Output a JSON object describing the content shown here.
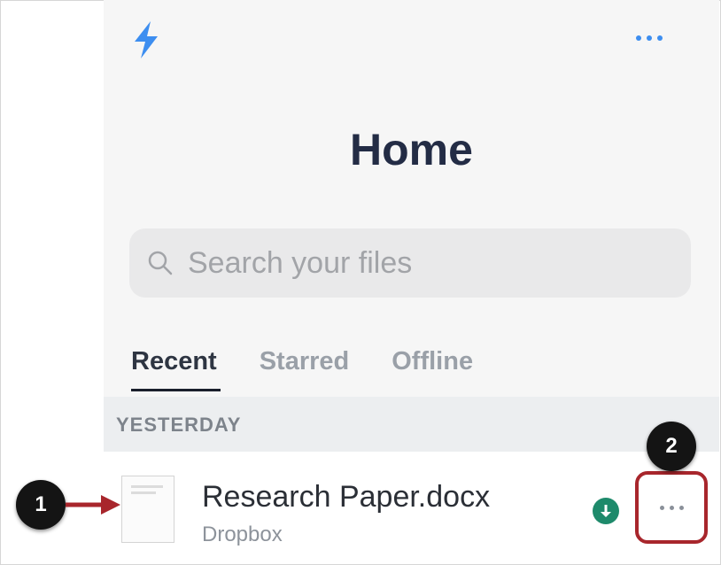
{
  "app": {
    "brand_icon": "lightning-bolt-icon",
    "more_icon": "ellipsis-icon"
  },
  "header": {
    "title": "Home"
  },
  "search": {
    "placeholder": "Search your files",
    "icon": "search-icon"
  },
  "tabs": [
    {
      "label": "Recent",
      "active": true
    },
    {
      "label": "Starred",
      "active": false
    },
    {
      "label": "Offline",
      "active": false
    }
  ],
  "section": {
    "label": "YESTERDAY"
  },
  "files": [
    {
      "name": "Research Paper.docx",
      "location": "Dropbox",
      "icon": "document-icon",
      "status_icon": "offline-download-icon"
    }
  ],
  "callouts": [
    {
      "number": "1"
    },
    {
      "number": "2"
    }
  ],
  "colors": {
    "accent": "#3d8ef0",
    "title": "#232c45",
    "offline_badge": "#1e8a6b",
    "callout_highlight": "#a8262c"
  }
}
